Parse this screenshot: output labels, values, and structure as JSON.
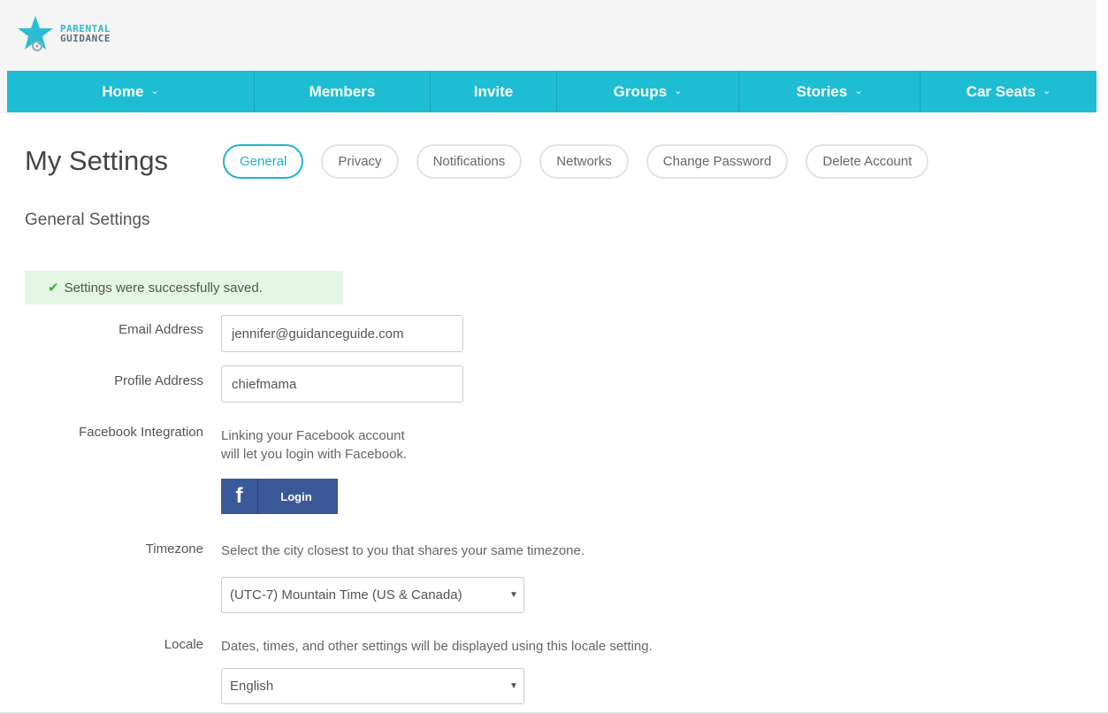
{
  "brand": {
    "line1": "PARENTAL",
    "line2": "GUIDANCE",
    "accent_color": "#1ebdd3"
  },
  "nav": {
    "items": [
      {
        "label": "Home",
        "has_dropdown": true
      },
      {
        "label": "Members",
        "has_dropdown": false
      },
      {
        "label": "Invite",
        "has_dropdown": false
      },
      {
        "label": "Groups",
        "has_dropdown": true
      },
      {
        "label": "Stories",
        "has_dropdown": true
      },
      {
        "label": "Car Seats",
        "has_dropdown": true
      }
    ]
  },
  "page": {
    "title": "My Settings",
    "section_title": "General Settings"
  },
  "tabs": [
    {
      "label": "General",
      "active": true
    },
    {
      "label": "Privacy",
      "active": false
    },
    {
      "label": "Notifications",
      "active": false
    },
    {
      "label": "Networks",
      "active": false
    },
    {
      "label": "Change Password",
      "active": false
    },
    {
      "label": "Delete Account",
      "active": false
    }
  ],
  "alert": {
    "message": "Settings were successfully saved.",
    "color": "#3dab3d"
  },
  "form": {
    "email": {
      "label": "Email Address",
      "value": "jennifer@guidanceguide.com"
    },
    "profile": {
      "label": "Profile Address",
      "value": "chiefmama"
    },
    "facebook": {
      "label": "Facebook Integration",
      "help_line1": "Linking your Facebook account",
      "help_line2": "will let you login with Facebook.",
      "button_icon": "f",
      "button_label": "Login",
      "button_color": "#3b5998"
    },
    "timezone": {
      "label": "Timezone",
      "help": "Select the city closest to you that shares your same timezone.",
      "value": "(UTC-7) Mountain Time (US & Canada)"
    },
    "locale": {
      "label": "Locale",
      "help": "Dates, times, and other settings will be displayed using this locale setting.",
      "value": "English"
    }
  }
}
